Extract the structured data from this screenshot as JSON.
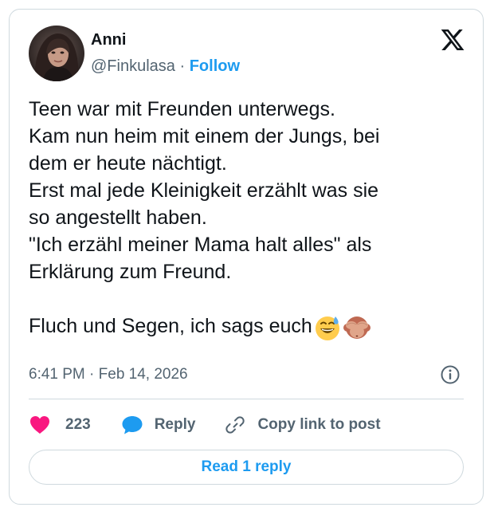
{
  "author": {
    "name": "Anni",
    "handle": "@Finkulasa",
    "separator": "·",
    "follow_label": "Follow",
    "avatar_icon": "profile-photo"
  },
  "post": {
    "lines": [
      "Teen war mit Freunden unterwegs.",
      "Kam nun heim mit einem der Jungs, bei",
      "dem er heute nächtigt.",
      "Erst mal jede Kleinigkeit erzählt was sie",
      "so angestellt haben.",
      "\"Ich erzähl meiner Mama halt alles\" als",
      "Erklärung zum Freund.",
      "Fluch und Segen, ich sags euch"
    ],
    "emojis": [
      "grinning-face-with-sweat-emoji",
      "see-no-evil-monkey-emoji"
    ]
  },
  "meta": {
    "timestamp": "6:41 PM · Feb 14, 2026"
  },
  "actions": {
    "like_count": "223",
    "reply_label": "Reply",
    "copy_label": "Copy link to post"
  },
  "footer": {
    "read_replies_label": "Read 1 reply"
  },
  "colors": {
    "accent": "#1d9bf0",
    "like": "#f91880",
    "text": "#0f1419",
    "muted": "#536471",
    "border": "#cfd9de"
  }
}
